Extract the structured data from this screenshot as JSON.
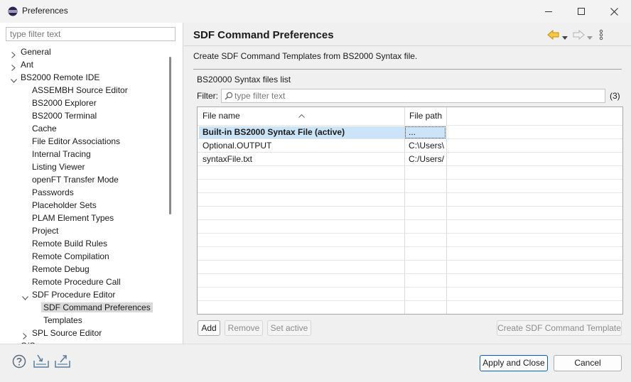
{
  "window": {
    "title": "Preferences"
  },
  "sidebar": {
    "filter_placeholder": "type filter text",
    "items": [
      {
        "label": "General",
        "twisty": "collapsed"
      },
      {
        "label": "Ant",
        "twisty": "collapsed"
      },
      {
        "label": "BS2000 Remote IDE",
        "twisty": "expanded"
      },
      {
        "label": "ASSEMBH Source Editor"
      },
      {
        "label": "BS2000 Explorer"
      },
      {
        "label": "BS2000 Terminal"
      },
      {
        "label": "Cache"
      },
      {
        "label": "File Editor Associations"
      },
      {
        "label": "Internal Tracing"
      },
      {
        "label": "Listing Viewer"
      },
      {
        "label": "openFT Transfer Mode"
      },
      {
        "label": "Passwords"
      },
      {
        "label": "Placeholder Sets"
      },
      {
        "label": "PLAM Element Types"
      },
      {
        "label": "Project"
      },
      {
        "label": "Remote Build Rules"
      },
      {
        "label": "Remote Compilation"
      },
      {
        "label": "Remote Debug"
      },
      {
        "label": "Remote Procedure Call"
      },
      {
        "label": "SDF Procedure Editor",
        "twisty": "expanded"
      },
      {
        "label": "SDF Command Preferences",
        "selected": true
      },
      {
        "label": "Templates"
      },
      {
        "label": "SPL Source Editor",
        "twisty": "collapsed"
      },
      {
        "label": "C/C++"
      }
    ]
  },
  "main": {
    "title": "SDF Command Preferences",
    "description": "Create SDF Command Templates from BS2000 Syntax file.",
    "list_label": "BS20000 Syntax files list",
    "filter_label": "Filter:",
    "filter_placeholder": "type filter text",
    "count": "(3)",
    "columns": {
      "name": "File name",
      "path": "File path"
    },
    "rows": [
      {
        "name": "Built-in BS2000 Syntax File (active)",
        "path": "...",
        "active": true
      },
      {
        "name": "Optional.OUTPUT",
        "path": "C:\\Users\\"
      },
      {
        "name": "syntaxFile.txt",
        "path": "C:/Users/"
      }
    ],
    "buttons": {
      "add": "Add",
      "remove": "Remove",
      "set_active": "Set active",
      "create_template": "Create SDF Command Template"
    }
  },
  "footer": {
    "apply_close": "Apply and Close",
    "cancel": "Cancel"
  },
  "colors": {
    "accent": "#005fb8",
    "selection": "#cce4f7",
    "back_arrow": "#e8a500"
  },
  "icons": [
    "help-icon",
    "import-icon",
    "export-icon",
    "back-icon",
    "forward-icon",
    "menu-icon"
  ]
}
